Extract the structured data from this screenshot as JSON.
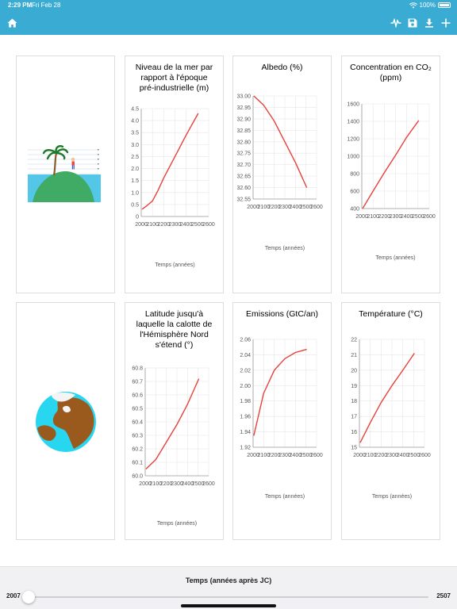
{
  "status_bar": {
    "time": "2:29 PM",
    "date": "Fri Feb 28",
    "battery": "100%"
  },
  "toolbar": {
    "home_icon": "home-icon",
    "pulse_icon": "activity-icon",
    "save_icon": "save-icon",
    "download_icon": "download-icon",
    "add_icon": "plus-icon"
  },
  "colors": {
    "accent": "#3aabd2",
    "line": "#e8403a",
    "slider": "#1a7cf6"
  },
  "cards": [
    {
      "kind": "illustration",
      "icon": "island-icon"
    },
    {
      "kind": "chart",
      "title_lines": [
        "Niveau de la mer par",
        "rapport à l'époque",
        "pré-industrielle (m)"
      ],
      "xlabel": "Temps (années)"
    },
    {
      "kind": "chart",
      "title_lines": [
        "Albedo (%)"
      ],
      "xlabel": "Temps (années)"
    },
    {
      "kind": "chart",
      "title_lines": [
        "Concentration en CO₂",
        "(ppm)"
      ],
      "xlabel": "Temps (années)"
    },
    {
      "kind": "illustration",
      "icon": "earth-globe-icon"
    },
    {
      "kind": "chart",
      "title_lines": [
        "Latitude jusqu'à",
        "laquelle la calotte de",
        "l'Hémisphère Nord",
        "s'étend (°)"
      ],
      "xlabel": "Temps (années)"
    },
    {
      "kind": "chart",
      "title_lines": [
        "Emissions (GtC/an)"
      ],
      "xlabel": "Temps (années)"
    },
    {
      "kind": "chart",
      "title_lines": [
        "Température (°C)"
      ],
      "xlabel": "Temps (années)"
    }
  ],
  "chart_data": [
    {
      "type": "line",
      "title": "Niveau de la mer par rapport à l'époque pré-industrielle (m)",
      "xlabel": "Temps (années)",
      "ylabel": "",
      "xticks": [
        "2000",
        "2100",
        "2200",
        "2300",
        "2400",
        "2500",
        "2600"
      ],
      "yticks": [
        "0",
        "0.5",
        "1.0",
        "1.5",
        "2.0",
        "2.5",
        "3.0",
        "3.5",
        "4.0",
        "4.5"
      ],
      "xlim": [
        2000,
        2600
      ],
      "ylim": [
        0,
        4.5
      ],
      "series": [
        {
          "x": [
            2007,
            2050,
            2100,
            2150,
            2200,
            2300,
            2400,
            2507
          ],
          "y": [
            0.3,
            0.45,
            0.65,
            1.1,
            1.6,
            2.5,
            3.4,
            4.3
          ]
        }
      ]
    },
    {
      "type": "line",
      "title": "Albedo (%)",
      "xlabel": "Temps (années)",
      "ylabel": "",
      "xticks": [
        "2000",
        "2100",
        "2200",
        "2300",
        "2400",
        "2500",
        "2600"
      ],
      "yticks": [
        "32.55",
        "32.60",
        "32.65",
        "32.70",
        "32.75",
        "32.80",
        "32.85",
        "32.90",
        "32.95",
        "33.00"
      ],
      "xlim": [
        2000,
        2600
      ],
      "ylim": [
        32.55,
        33.0
      ],
      "series": [
        {
          "x": [
            2007,
            2100,
            2200,
            2300,
            2400,
            2507
          ],
          "y": [
            33.0,
            32.96,
            32.89,
            32.8,
            32.71,
            32.6
          ]
        }
      ]
    },
    {
      "type": "line",
      "title": "Concentration en CO2 (ppm)",
      "xlabel": "Temps (années)",
      "ylabel": "",
      "xticks": [
        "2000",
        "2100",
        "2200",
        "2300",
        "2400",
        "2500",
        "2600"
      ],
      "yticks": [
        "400",
        "600",
        "800",
        "1000",
        "1200",
        "1400",
        "1600"
      ],
      "xlim": [
        2000,
        2600
      ],
      "ylim": [
        400,
        1600
      ],
      "series": [
        {
          "x": [
            2007,
            2100,
            2200,
            2300,
            2400,
            2507
          ],
          "y": [
            400,
            600,
            810,
            1010,
            1220,
            1410
          ]
        }
      ]
    },
    {
      "type": "line",
      "title": "Latitude jusqu'à laquelle la calotte de l'Hémisphère Nord s'étend (°)",
      "xlabel": "Temps (années)",
      "ylabel": "",
      "xticks": [
        "2000",
        "2100",
        "2200",
        "2300",
        "2400",
        "2500",
        "2600"
      ],
      "yticks": [
        "60.0",
        "60.1",
        "60.2",
        "60.3",
        "60.4",
        "60.5",
        "60.6",
        "60.7",
        "60.8"
      ],
      "xlim": [
        2000,
        2600
      ],
      "ylim": [
        60.0,
        60.8
      ],
      "series": [
        {
          "x": [
            2007,
            2100,
            2200,
            2300,
            2400,
            2507
          ],
          "y": [
            60.05,
            60.12,
            60.25,
            60.38,
            60.53,
            60.72
          ]
        }
      ]
    },
    {
      "type": "line",
      "title": "Emissions (GtC/an)",
      "xlabel": "Temps (années)",
      "ylabel": "",
      "xticks": [
        "2000",
        "2100",
        "2200",
        "2300",
        "2400",
        "2500",
        "2600"
      ],
      "yticks": [
        "1.92",
        "1.94",
        "1.96",
        "1.98",
        "2.00",
        "2.02",
        "2.04",
        "2.06"
      ],
      "xlim": [
        2000,
        2600
      ],
      "ylim": [
        1.92,
        2.06
      ],
      "series": [
        {
          "x": [
            2007,
            2100,
            2200,
            2300,
            2400,
            2507
          ],
          "y": [
            1.935,
            1.99,
            2.02,
            2.035,
            2.043,
            2.047
          ]
        }
      ]
    },
    {
      "type": "line",
      "title": "Température (°C)",
      "xlabel": "Temps (années)",
      "ylabel": "",
      "xticks": [
        "2000",
        "2100",
        "2200",
        "2300",
        "2400",
        "2500",
        "2600"
      ],
      "yticks": [
        "15",
        "16",
        "17",
        "18",
        "19",
        "20",
        "21",
        "22"
      ],
      "xlim": [
        2000,
        2600
      ],
      "ylim": [
        15,
        22
      ],
      "series": [
        {
          "x": [
            2007,
            2100,
            2200,
            2300,
            2400,
            2507
          ],
          "y": [
            15.3,
            16.6,
            17.9,
            19.0,
            20.0,
            21.1
          ]
        }
      ]
    }
  ],
  "slider": {
    "title": "Temps (années après JC)",
    "min_label": "2007",
    "max_label": "2507",
    "min": 2007,
    "max": 2507,
    "value": 2007
  }
}
